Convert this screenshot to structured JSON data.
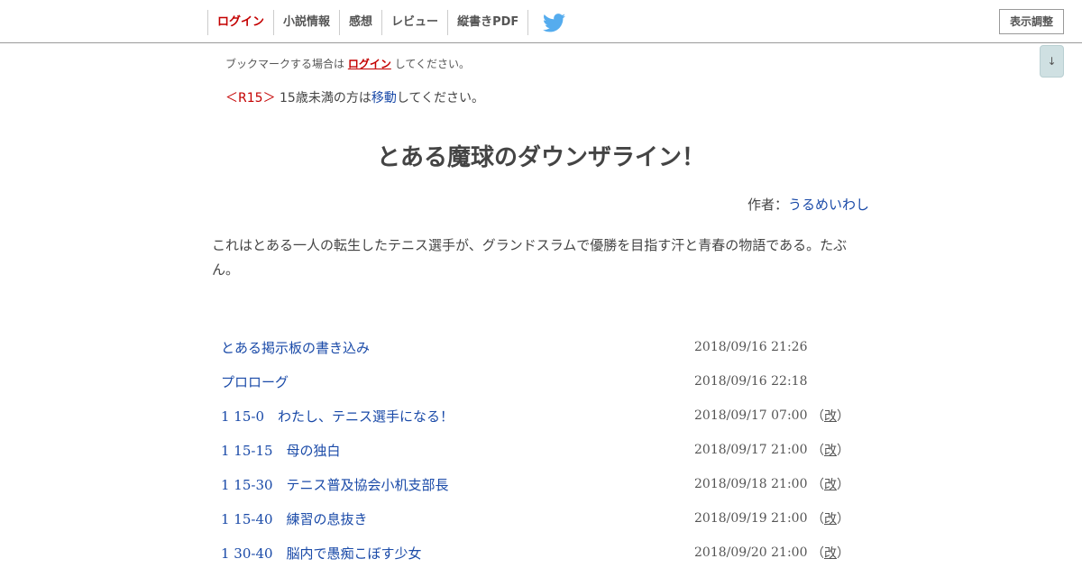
{
  "nav": {
    "items": [
      "ログイン",
      "小説情報",
      "感想",
      "レビュー",
      "縦書きPDF"
    ],
    "twitter_color": "#55acee",
    "display_settings_label": "表示調整",
    "scroll_label": "↓"
  },
  "bookmark_note": {
    "prefix": "ブックマークする場合は",
    "link": "ログイン",
    "suffix": "してください。"
  },
  "rating_note": {
    "tag": "＜R15＞",
    "prefix": "15歳未満の方は",
    "link": "移動",
    "suffix": "してください。"
  },
  "novel": {
    "title": "とある魔球のダウンザライン！",
    "author_label": "作者：",
    "author_name": "うるめいわし",
    "synopsis": "これはとある一人の転生したテニス選手が、グランドスラムで優勝を目指す汗と青春の物語である。たぶん。"
  },
  "chapters": [
    {
      "title": "とある掲示板の書き込み",
      "date": "2018/09/16 21:26",
      "revised": false
    },
    {
      "title": "プロローグ",
      "date": "2018/09/16 22:18",
      "revised": false
    },
    {
      "title": "1 15-0　わたし、テニス選手になる！",
      "date": "2018/09/17 07:00",
      "revised": true
    },
    {
      "title": "1 15-15　母の独白",
      "date": "2018/09/17 21:00",
      "revised": true
    },
    {
      "title": "1 15-30　テニス普及協会小机支部長",
      "date": "2018/09/18 21:00",
      "revised": true
    },
    {
      "title": "1 15-40　練習の息抜き",
      "date": "2018/09/19 21:00",
      "revised": true
    },
    {
      "title": "1 30-40　脳内で愚痴こぼす少女",
      "date": "2018/09/20 21:00",
      "revised": true
    }
  ],
  "revision_label": "改",
  "colors": {
    "link": "#1a4aa8",
    "accent_red": "#c40000",
    "text": "#444444"
  }
}
